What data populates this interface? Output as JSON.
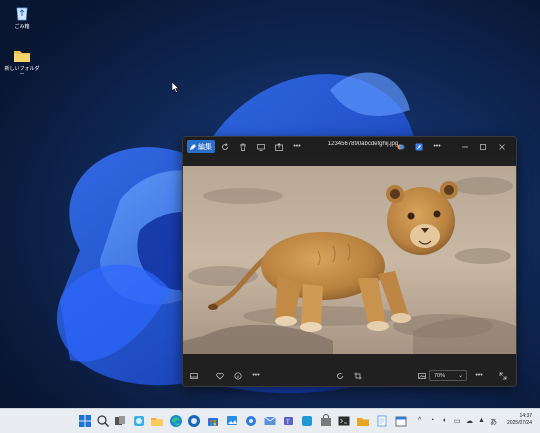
{
  "desktop": {
    "icons": [
      {
        "label": "ごみ箱",
        "icon": "recycle-bin-icon"
      },
      {
        "label": "新しいフォルダー",
        "icon": "folder-icon"
      }
    ]
  },
  "photos_window": {
    "edit_label": "編集",
    "filename": "1234567890abcdefghij.jpg",
    "zoom_value": "70%",
    "toolbar_icons": [
      "rotate-icon",
      "delete-icon",
      "slideshow-icon",
      "share-icon",
      "more-icon",
      "copilot-icon",
      "paint-icon",
      "more-icon"
    ],
    "window_controls": [
      "minimize-icon",
      "maximize-icon",
      "close-icon"
    ],
    "bottom_icons": [
      "filmstrip-icon",
      "favorite-icon",
      "info-icon",
      "more-icon",
      "rotate-icon",
      "crop-icon",
      "fit-icon",
      "chevron-down-icon",
      "more-icon",
      "fullscreen-icon"
    ]
  },
  "taskbar": {
    "time": "14:37",
    "date": "2025/07/24",
    "apps": [
      "start-icon",
      "search-icon",
      "task-view-icon",
      "widgets-icon",
      "file-explorer-icon",
      "edge-icon",
      "edge-dev-icon",
      "store-icon",
      "photos-icon",
      "settings-icon",
      "mail-icon",
      "teams-icon",
      "terminal-icon",
      "folder-icon",
      "notepad-icon",
      "calendar-icon"
    ],
    "colors": {
      "taskbar_bg": "#e9edf2",
      "accent": "#2c6fc8"
    }
  }
}
